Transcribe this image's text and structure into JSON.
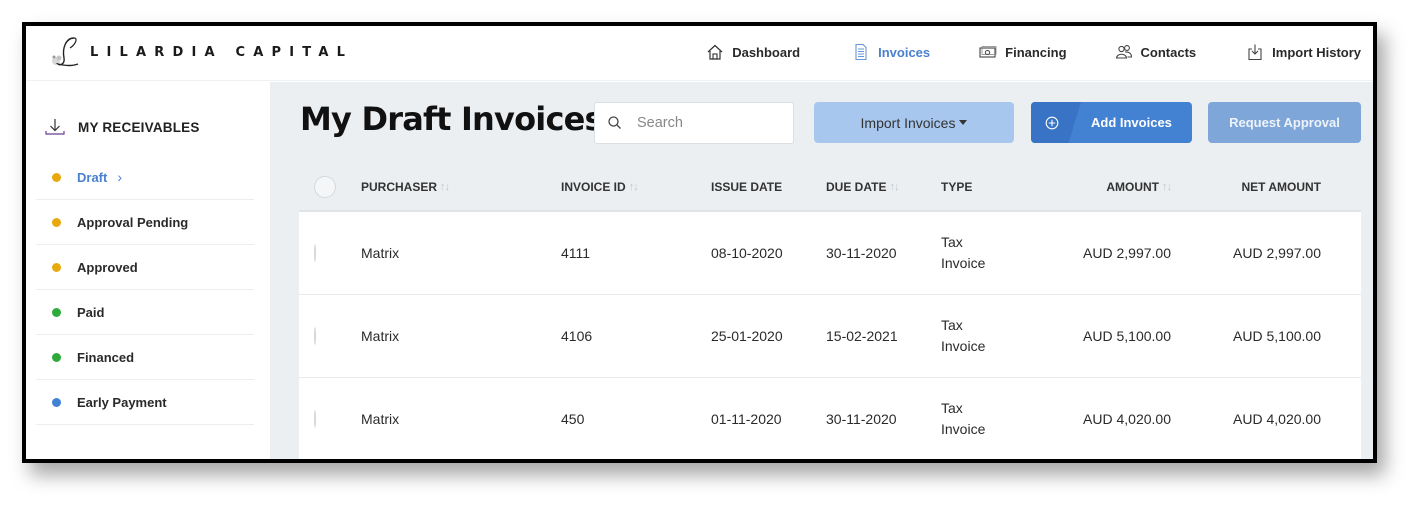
{
  "brand": {
    "name": "LILARDIA CAPITAL",
    "logo_icon": "script-L-floral-logo"
  },
  "nav": [
    {
      "label": "Dashboard",
      "icon": "home-icon",
      "active": false
    },
    {
      "label": "Invoices",
      "icon": "document-icon",
      "active": true
    },
    {
      "label": "Financing",
      "icon": "cash-icon",
      "active": false
    },
    {
      "label": "Contacts",
      "icon": "users-icon",
      "active": false
    },
    {
      "label": "Import History",
      "icon": "import-icon",
      "active": false
    }
  ],
  "sidebar": {
    "title": "MY RECEIVABLES",
    "title_icon": "download-icon",
    "items": [
      {
        "label": "Draft",
        "color": "#e8a90f",
        "active": true
      },
      {
        "label": "Approval Pending",
        "color": "#e8a90f",
        "active": false
      },
      {
        "label": "Approved",
        "color": "#e8a90f",
        "active": false
      },
      {
        "label": "Paid",
        "color": "#2eaa3a",
        "active": false
      },
      {
        "label": "Financed",
        "color": "#2eaa3a",
        "active": false
      },
      {
        "label": "Early Payment",
        "color": "#3f82d6",
        "active": false
      }
    ]
  },
  "main": {
    "title": "My Draft Invoices",
    "search": {
      "placeholder": "Search",
      "value": ""
    },
    "buttons": {
      "import": "Import Invoices",
      "add": "Add Invoices",
      "request": "Request Approval"
    },
    "table": {
      "columns": [
        {
          "label": "PURCHASER",
          "sortable": true
        },
        {
          "label": "INVOICE ID",
          "sortable": true
        },
        {
          "label": "ISSUE DATE",
          "sortable": false
        },
        {
          "label": "DUE DATE",
          "sortable": true
        },
        {
          "label": "TYPE",
          "sortable": false
        },
        {
          "label": "AMOUNT",
          "sortable": true
        },
        {
          "label": "NET AMOUNT",
          "sortable": false
        }
      ],
      "sort_glyph": "↑↓",
      "rows": [
        {
          "purchaser": "Matrix",
          "invoice_id": "4111",
          "issue_date": "08-10-2020",
          "due_date": "30-11-2020",
          "type_line1": "Tax",
          "type_line2": "Invoice",
          "amount": "AUD 2,997.00",
          "net_amount": "AUD 2,997.00"
        },
        {
          "purchaser": "Matrix",
          "invoice_id": "4106",
          "issue_date": "25-01-2020",
          "due_date": "15-02-2021",
          "type_line1": "Tax",
          "type_line2": "Invoice",
          "amount": "AUD 5,100.00",
          "net_amount": "AUD 5,100.00"
        },
        {
          "purchaser": "Matrix",
          "invoice_id": "450",
          "issue_date": "01-11-2020",
          "due_date": "30-11-2020",
          "type_line1": "Tax",
          "type_line2": "Invoice",
          "amount": "AUD 4,020.00",
          "net_amount": "AUD 4,020.00"
        }
      ]
    }
  }
}
